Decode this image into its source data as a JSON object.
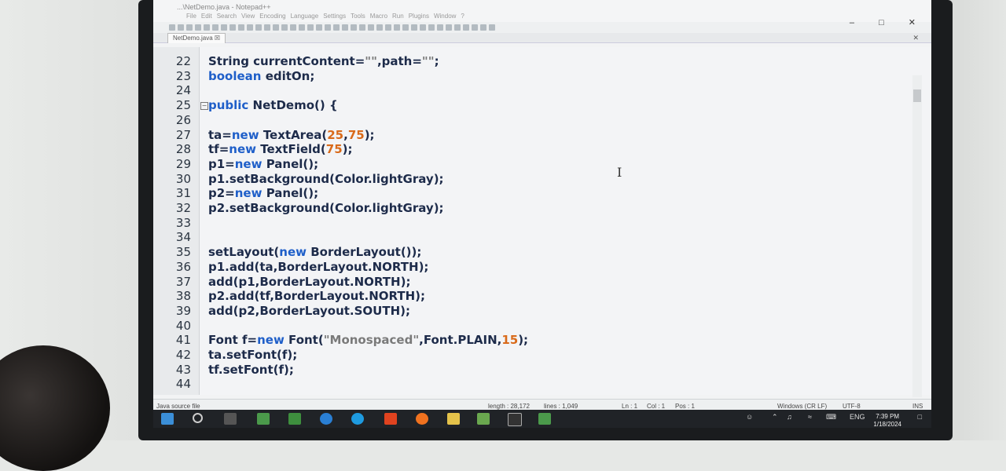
{
  "window": {
    "title": "...\\NetDemo.java - Notepad++",
    "menu": [
      "File",
      "Edit",
      "Search",
      "View",
      "Encoding",
      "Language",
      "Settings",
      "Tools",
      "Macro",
      "Run",
      "Plugins",
      "Window",
      "?"
    ],
    "tab_label": "NetDemo.java"
  },
  "editor": {
    "lines": [
      {
        "num": "22",
        "segments": [
          {
            "t": "String currentContent=",
            "c": "p"
          },
          {
            "t": "\"\"",
            "c": "s"
          },
          {
            "t": ",path=",
            "c": "p"
          },
          {
            "t": "\"\"",
            "c": "s"
          },
          {
            "t": ";",
            "c": "p"
          }
        ]
      },
      {
        "num": "23",
        "segments": [
          {
            "t": "boolean",
            "c": "k"
          },
          {
            "t": " editOn;",
            "c": "p"
          }
        ]
      },
      {
        "num": "24",
        "segments": []
      },
      {
        "num": "25",
        "segments": [
          {
            "t": "public",
            "c": "k"
          },
          {
            "t": " NetDemo() {",
            "c": "p"
          }
        ],
        "fold": true
      },
      {
        "num": "26",
        "segments": []
      },
      {
        "num": "27",
        "segments": [
          {
            "t": "ta=",
            "c": "p"
          },
          {
            "t": "new",
            "c": "k"
          },
          {
            "t": " TextArea(",
            "c": "p"
          },
          {
            "t": "25",
            "c": "n"
          },
          {
            "t": ",",
            "c": "p"
          },
          {
            "t": "75",
            "c": "n"
          },
          {
            "t": ");",
            "c": "p"
          }
        ]
      },
      {
        "num": "28",
        "segments": [
          {
            "t": "tf=",
            "c": "p"
          },
          {
            "t": "new",
            "c": "k"
          },
          {
            "t": " TextField(",
            "c": "p"
          },
          {
            "t": "75",
            "c": "n"
          },
          {
            "t": ");",
            "c": "p"
          }
        ]
      },
      {
        "num": "29",
        "segments": [
          {
            "t": "p1=",
            "c": "p"
          },
          {
            "t": "new",
            "c": "k"
          },
          {
            "t": " Panel();",
            "c": "p"
          }
        ]
      },
      {
        "num": "30",
        "segments": [
          {
            "t": "p1.setBackground(Color.lightGray);",
            "c": "p"
          }
        ]
      },
      {
        "num": "31",
        "segments": [
          {
            "t": "p2=",
            "c": "p"
          },
          {
            "t": "new",
            "c": "k"
          },
          {
            "t": " Panel();",
            "c": "p"
          }
        ]
      },
      {
        "num": "32",
        "segments": [
          {
            "t": "p2.setBackground(Color.lightGray);",
            "c": "p"
          }
        ]
      },
      {
        "num": "33",
        "segments": []
      },
      {
        "num": "34",
        "segments": []
      },
      {
        "num": "35",
        "segments": [
          {
            "t": "setLayout(",
            "c": "p"
          },
          {
            "t": "new",
            "c": "k"
          },
          {
            "t": " BorderLayout());",
            "c": "p"
          }
        ]
      },
      {
        "num": "36",
        "segments": [
          {
            "t": "p1.add(ta,BorderLayout.NORTH);",
            "c": "p"
          }
        ]
      },
      {
        "num": "37",
        "segments": [
          {
            "t": "add(p1,BorderLayout.NORTH);",
            "c": "p"
          }
        ]
      },
      {
        "num": "38",
        "segments": [
          {
            "t": "p2.add(tf,BorderLayout.NORTH);",
            "c": "p"
          }
        ]
      },
      {
        "num": "39",
        "segments": [
          {
            "t": "add(p2,BorderLayout.SOUTH);",
            "c": "p"
          }
        ]
      },
      {
        "num": "40",
        "segments": []
      },
      {
        "num": "41",
        "segments": [
          {
            "t": "Font f=",
            "c": "p"
          },
          {
            "t": "new",
            "c": "k"
          },
          {
            "t": " Font(",
            "c": "p"
          },
          {
            "t": "\"Monospaced\"",
            "c": "s"
          },
          {
            "t": ",Font.PLAIN,",
            "c": "p"
          },
          {
            "t": "15",
            "c": "n"
          },
          {
            "t": ");",
            "c": "p"
          }
        ]
      },
      {
        "num": "42",
        "segments": [
          {
            "t": "ta.setFont(f);",
            "c": "p"
          }
        ]
      },
      {
        "num": "43",
        "segments": [
          {
            "t": "tf.setFont(f);",
            "c": "p"
          }
        ]
      },
      {
        "num": "44",
        "segments": []
      }
    ]
  },
  "status": {
    "filetype": "Java source file",
    "length": "length : 28,172",
    "lines": "lines : 1,049",
    "ln": "Ln : 1",
    "col": "Col : 1",
    "pos": "Pos : 1",
    "eol": "Windows (CR LF)",
    "encoding": "UTF-8",
    "mode": "INS"
  },
  "taskbar": {
    "lang": "ENG",
    "time": "7:39 PM",
    "date": "1/18/2024"
  }
}
